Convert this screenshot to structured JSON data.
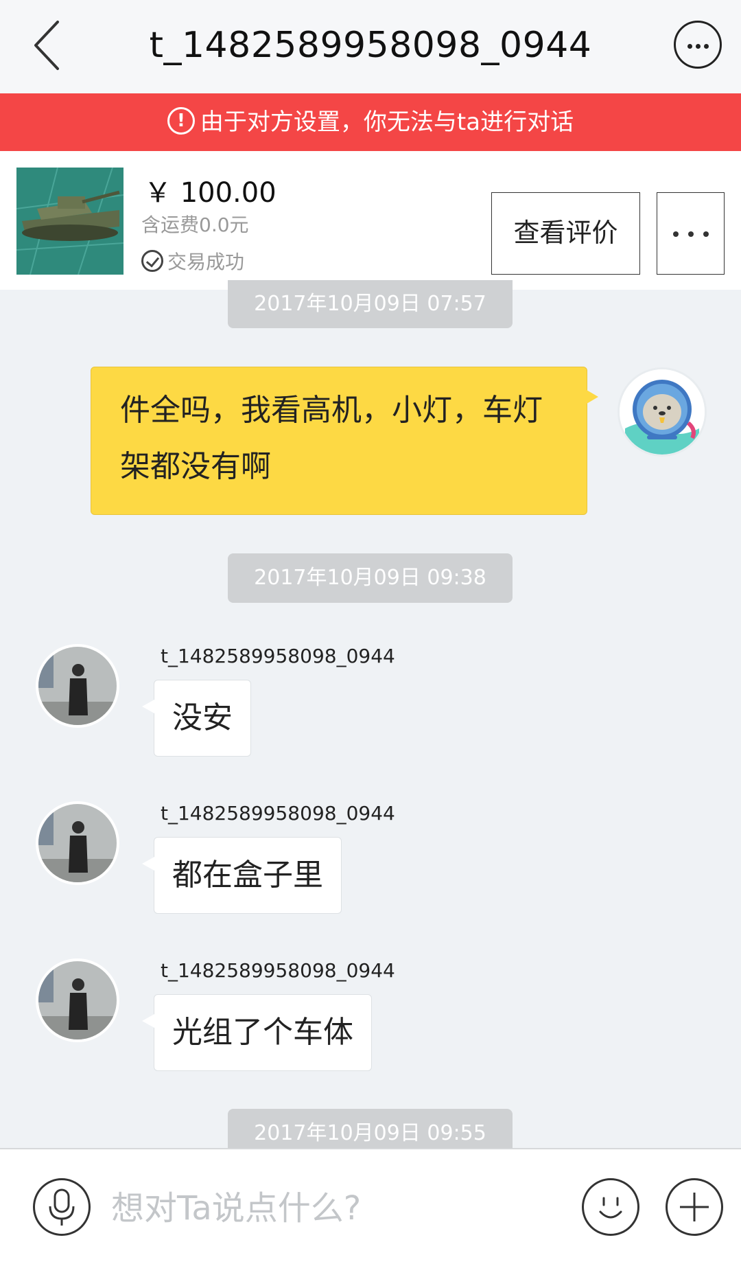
{
  "header": {
    "title": "t_1482589958098_0944",
    "back_icon": "chevron-left-icon",
    "more_icon": "more-circle-icon"
  },
  "banner": {
    "text": "由于对方设置，你无法与ta进行对话",
    "icon_text": "!",
    "color": "#f44646"
  },
  "product": {
    "price": "￥ 100.00",
    "shipping": "含运费0.0元",
    "status": "交易成功",
    "review_button": "查看评价",
    "thumbnail": "tank-model-photo"
  },
  "messages": {
    "time1": "2017年10月09日 07:57",
    "out1": "件全吗，我看高机，小灯，车灯架都没有啊",
    "time2": "2017年10月09日 09:38",
    "in1": {
      "sender": "t_1482589958098_0944",
      "text": "没安"
    },
    "in2": {
      "sender": "t_1482589958098_0944",
      "text": "都在盒子里"
    },
    "in3": {
      "sender": "t_1482589958098_0944",
      "text": "光组了个车体"
    },
    "time3": "2017年10月09日 09:55"
  },
  "input": {
    "placeholder": "想对Ta说点什么?",
    "voice_icon": "microphone-icon",
    "emoji_icon": "smiley-icon",
    "plus_icon": "plus-icon"
  },
  "colors": {
    "accent_yellow": "#fdd944",
    "chat_background": "#eff2f5",
    "time_pill": "#cfd1d3"
  }
}
